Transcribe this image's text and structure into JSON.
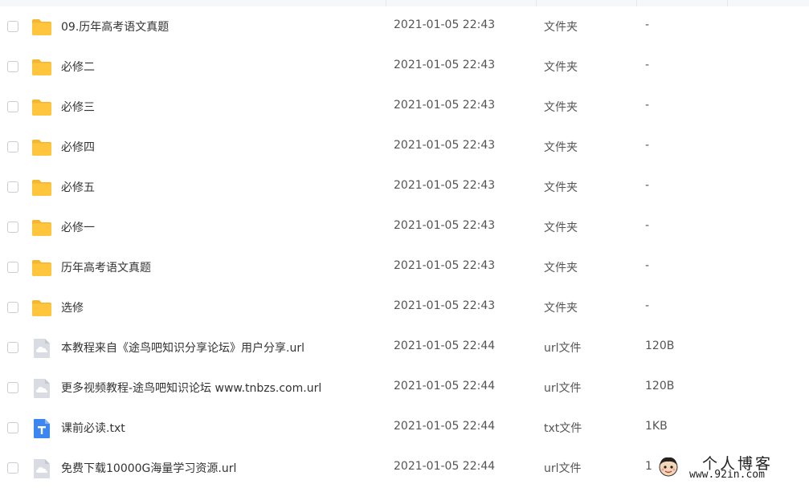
{
  "files": [
    {
      "name": "09.历年高考语文真题",
      "time": "2021-01-05 22:43",
      "type": "文件夹",
      "size": "-",
      "icon": "folder-icon"
    },
    {
      "name": "必修二",
      "time": "2021-01-05 22:43",
      "type": "文件夹",
      "size": "-",
      "icon": "folder-icon"
    },
    {
      "name": "必修三",
      "time": "2021-01-05 22:43",
      "type": "文件夹",
      "size": "-",
      "icon": "folder-icon"
    },
    {
      "name": "必修四",
      "time": "2021-01-05 22:43",
      "type": "文件夹",
      "size": "-",
      "icon": "folder-icon"
    },
    {
      "name": "必修五",
      "time": "2021-01-05 22:43",
      "type": "文件夹",
      "size": "-",
      "icon": "folder-icon"
    },
    {
      "name": "必修一",
      "time": "2021-01-05 22:43",
      "type": "文件夹",
      "size": "-",
      "icon": "folder-icon"
    },
    {
      "name": "历年高考语文真题",
      "time": "2021-01-05 22:43",
      "type": "文件夹",
      "size": "-",
      "icon": "folder-icon"
    },
    {
      "name": "选修",
      "time": "2021-01-05 22:43",
      "type": "文件夹",
      "size": "-",
      "icon": "folder-icon"
    },
    {
      "name": "本教程来自《途鸟吧知识分享论坛》用户分享.url",
      "time": "2021-01-05 22:44",
      "type": "url文件",
      "size": "120B",
      "icon": "url-file-icon"
    },
    {
      "name": "更多视频教程-途鸟吧知识论坛 www.tnbzs.com.url",
      "time": "2021-01-05 22:44",
      "type": "url文件",
      "size": "120B",
      "icon": "url-file-icon"
    },
    {
      "name": "课前必读.txt",
      "time": "2021-01-05 22:44",
      "type": "txt文件",
      "size": "1KB",
      "icon": "txt-file-icon"
    },
    {
      "name": "免费下载10000G海量学习资源.url",
      "time": "2021-01-05 22:44",
      "type": "url文件",
      "size": "1",
      "icon": "url-file-icon"
    }
  ],
  "watermark": {
    "title": "个人博客",
    "url": "www.92in.com"
  },
  "colors": {
    "folder": "#ffc53d",
    "folder_tab": "#f5b731",
    "url_file": "#d9dde3",
    "txt_file": "#3b86f2"
  }
}
